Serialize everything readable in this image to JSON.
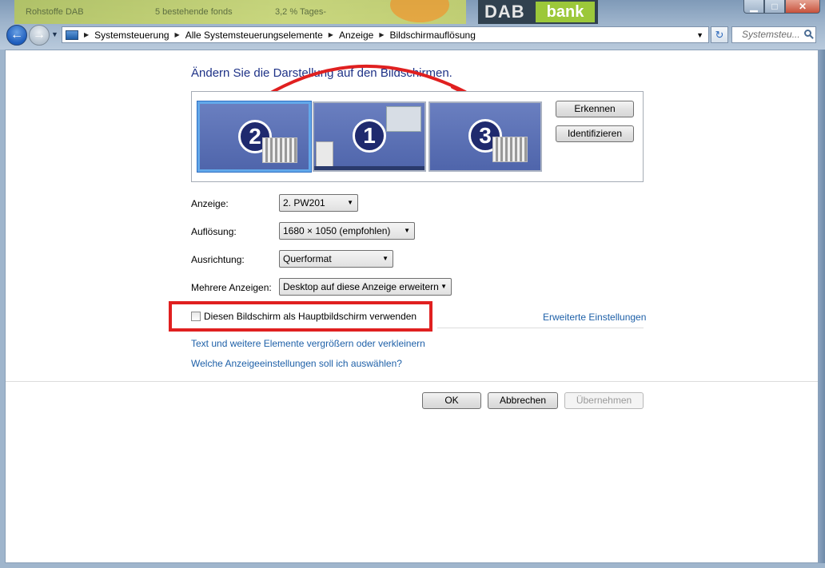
{
  "background": {
    "banner_text_1": "Rohstoffe DAB",
    "banner_text_2": "5 bestehende fonds",
    "banner_text_3": "3,2 % Tages-",
    "logo_left": "DAB",
    "logo_right": "bank"
  },
  "window": {
    "minimize_label": "▁",
    "maximize_label": "□",
    "close_label": "✕"
  },
  "address_bar": {
    "breadcrumbs": [
      "Systemsteuerung",
      "Alle Systemsteuerungselemente",
      "Anzeige",
      "Bildschirmauflösung"
    ]
  },
  "search": {
    "placeholder": "Systemsteu..."
  },
  "page": {
    "heading": "Ändern Sie die Darstellung auf den Bildschirmen.",
    "monitors": [
      {
        "number": "2",
        "selected": true
      },
      {
        "number": "1",
        "selected": false
      },
      {
        "number": "3",
        "selected": false
      }
    ],
    "detect_button": "Erkennen",
    "identify_button": "Identifizieren",
    "display_label": "Anzeige:",
    "display_value": "2. PW201",
    "resolution_label": "Auflösung:",
    "resolution_value": "1680 × 1050 (empfohlen)",
    "orientation_label": "Ausrichtung:",
    "orientation_value": "Querformat",
    "multiple_label": "Mehrere Anzeigen:",
    "multiple_value": "Desktop auf diese Anzeige erweitern",
    "primary_checkbox_label": "Diesen Bildschirm als Hauptbildschirm verwenden",
    "primary_checked": false,
    "advanced_link": "Erweiterte Einstellungen",
    "text_size_link": "Text und weitere Elemente vergrößern oder verkleinern",
    "which_settings_link": "Welche Anzeigeeinstellungen soll ich auswählen?"
  },
  "footer": {
    "ok": "OK",
    "cancel": "Abbrechen",
    "apply": "Übernehmen"
  },
  "colors": {
    "annotation_red": "#e02020",
    "heading_blue": "#1e3287",
    "link_blue": "#1e60a8",
    "monitor_blue": "#5a70b5"
  }
}
